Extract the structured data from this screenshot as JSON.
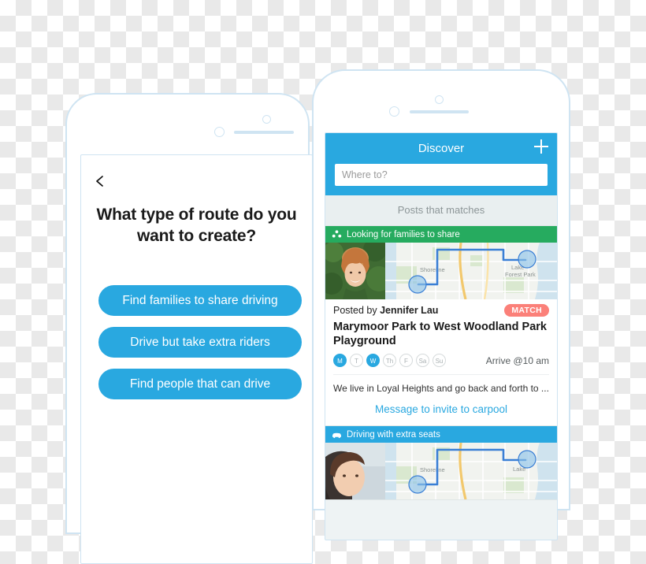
{
  "left_phone": {
    "back_icon": "chevron-left-icon",
    "question": "What type of route do you want to create?",
    "options": [
      {
        "label": "Find families to share driving"
      },
      {
        "label": "Drive but take extra riders"
      },
      {
        "label": "Find people that can drive"
      }
    ]
  },
  "right_phone": {
    "header": {
      "title": "Discover",
      "add_icon": "plus-icon"
    },
    "search": {
      "value": "",
      "placeholder": "Where to?"
    },
    "section_label": "Posts that matches",
    "posts": [
      {
        "banner": {
          "text": "Looking for families to share",
          "icon": "group-people-icon",
          "color": "#26ab5f"
        },
        "posted_prefix": "Posted by ",
        "author": "Jennifer Lau",
        "badge": "MATCH",
        "title": "Marymoor Park to West Woodland Park Playground",
        "days": [
          {
            "label": "M",
            "active": true
          },
          {
            "label": "T",
            "active": false
          },
          {
            "label": "W",
            "active": true
          },
          {
            "label": "Th",
            "active": false
          },
          {
            "label": "F",
            "active": false
          },
          {
            "label": "Sa",
            "active": false
          },
          {
            "label": "Su",
            "active": false
          }
        ],
        "arrive": "Arrive @10 am",
        "description": "We live in Loyal Heights and go back and forth to ...",
        "action_link": "Message to invite to carpool",
        "map": {
          "labels": [
            "Shoreline",
            "Lake Forest Park"
          ],
          "route_color": "#3a7fd5"
        }
      },
      {
        "banner": {
          "text": "Driving with extra seats",
          "icon": "car-icon",
          "color": "#29a8e0"
        },
        "map": {
          "labels": [
            "Shoreline",
            "Lake"
          ],
          "route_color": "#3a7fd5"
        }
      }
    ]
  },
  "colors": {
    "accent": "#29a8e0",
    "green": "#26ab5f",
    "badge": "#fb8079",
    "frame": "#cfe4f2"
  }
}
